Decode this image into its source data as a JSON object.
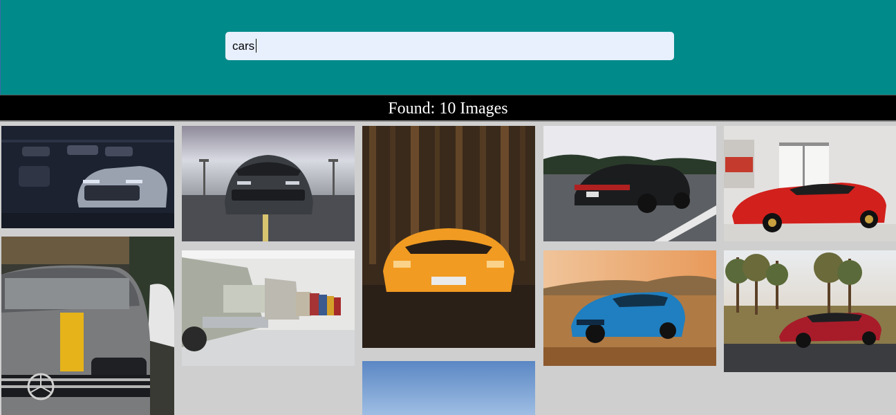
{
  "search": {
    "value": "cars"
  },
  "results": {
    "label": "Found: 10 Images"
  },
  "images": [
    {
      "name": "car-image-1",
      "desc": "white camaro dark garage"
    },
    {
      "name": "car-image-2",
      "desc": "gray mustang front"
    },
    {
      "name": "car-image-3",
      "desc": "orange lamborghini forest"
    },
    {
      "name": "car-image-4",
      "desc": "black porsche highway"
    },
    {
      "name": "car-image-5",
      "desc": "red ferrari showroom"
    },
    {
      "name": "car-image-6",
      "desc": "gray mercedes yellow stripe"
    },
    {
      "name": "car-image-7",
      "desc": "vintage bmw row"
    },
    {
      "name": "car-image-8",
      "desc": "sky"
    },
    {
      "name": "car-image-9",
      "desc": "blue camaro desert"
    },
    {
      "name": "car-image-10",
      "desc": "red mercedes trees"
    }
  ],
  "colors": {
    "header": "#008a8a",
    "search_bg": "#e8f0fe",
    "bar": "#000000",
    "grid_bg": "#cfcfcf"
  }
}
